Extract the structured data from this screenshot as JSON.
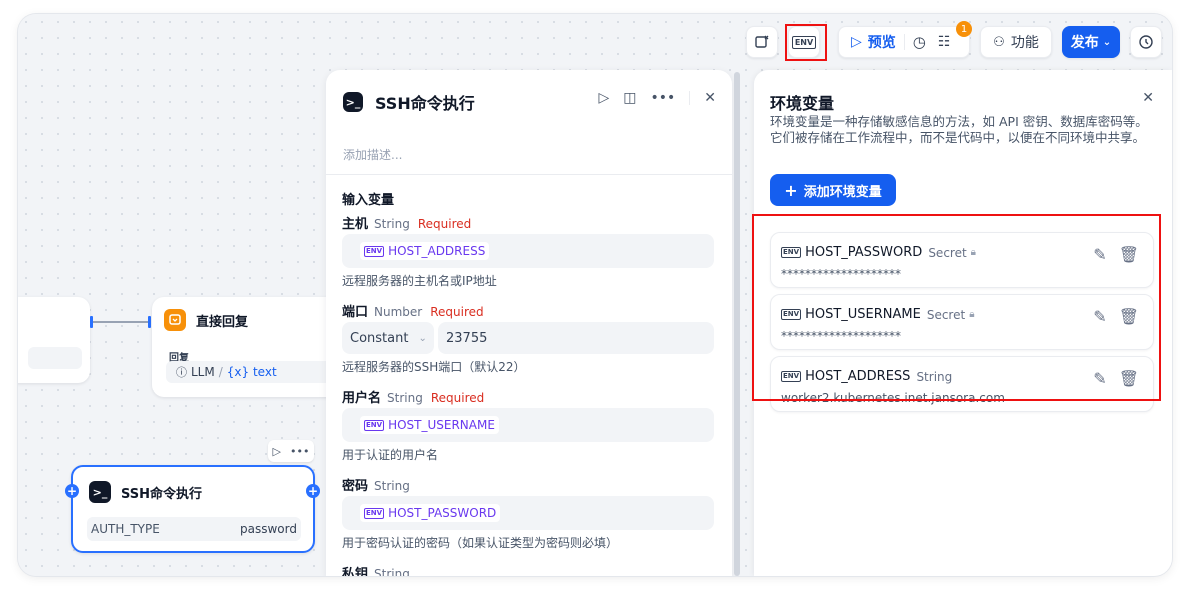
{
  "toolbar": {
    "env_label": "ENV",
    "preview_label": "预览",
    "badge_count": "1",
    "features_label": "功能",
    "publish_label": "发布"
  },
  "canvas": {
    "reply_node": {
      "title": "直接回复",
      "field_label": "回复",
      "llm": "LLM",
      "sep": "/",
      "var": "{x} text"
    },
    "ssh_node": {
      "title": "SSH命令执行",
      "key": "AUTH_TYPE",
      "value": "password"
    }
  },
  "ssh_panel": {
    "title": "SSH命令执行",
    "description_placeholder": "添加描述...",
    "section": "输入变量",
    "fields": [
      {
        "label": "主机",
        "type": "String",
        "required": "Required",
        "value": "HOST_ADDRESS",
        "help": "远程服务器的主机名或IP地址"
      },
      {
        "label": "端口",
        "type": "Number",
        "required": "Required",
        "mode": "Constant",
        "value": "23755",
        "help": "远程服务器的SSH端口（默认22）"
      },
      {
        "label": "用户名",
        "type": "String",
        "required": "Required",
        "value": "HOST_USERNAME",
        "help": "用于认证的用户名"
      },
      {
        "label": "密码",
        "type": "String",
        "value": "HOST_PASSWORD",
        "help": "用于密码认证的密码（如果认证类型为密码则必填）"
      },
      {
        "label": "私钥",
        "type": "String"
      }
    ]
  },
  "env_panel": {
    "title": "环境变量",
    "description": "环境变量是一种存储敏感信息的方法，如 API 密钥、数据库密码等。它们被存储在工作流程中，而不是代码中，以便在不同环境中共享。",
    "add_button": "添加环境变量",
    "items": [
      {
        "name": "HOST_PASSWORD",
        "type": "Secret",
        "value": "********************"
      },
      {
        "name": "HOST_USERNAME",
        "type": "Secret",
        "value": "********************"
      },
      {
        "name": "HOST_ADDRESS",
        "type": "String",
        "value": "worker2.kubernetes.inet.jansora.com"
      }
    ]
  },
  "colors": {
    "accent": "#155eef",
    "required": "#d92d20",
    "variable": "#6938ef",
    "highlight": "#ee1111"
  }
}
